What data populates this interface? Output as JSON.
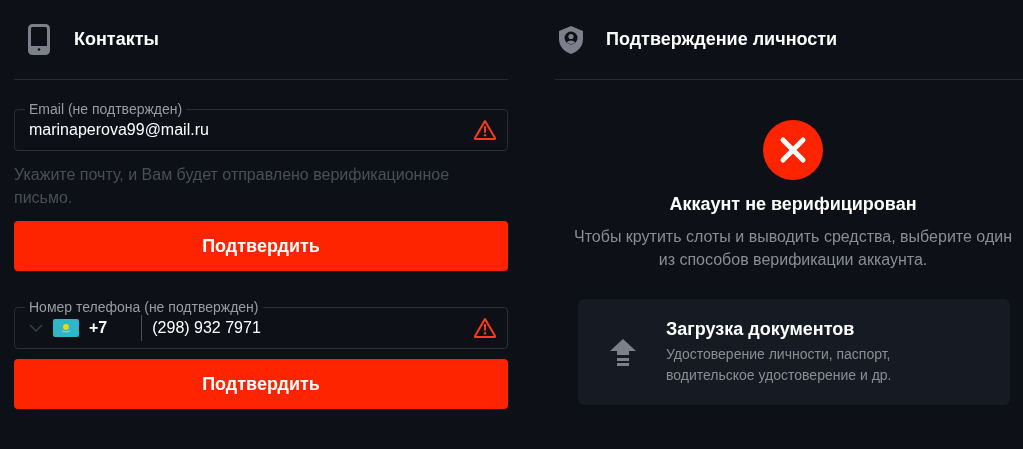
{
  "contacts": {
    "title": "Контакты",
    "fields": [
      {
        "kind": "email",
        "label": "Email (не подтвержден)",
        "value": "marinaperova99@mail.ru",
        "hint": "Укажите почту, и Вам будет отправлено верификационное письмо.",
        "button": "Подтвердить"
      },
      {
        "kind": "phone",
        "label": "Номер телефона (не подтвержден)",
        "country_code": "+7",
        "value": "(298) 932 7971",
        "button": "Подтвердить"
      }
    ]
  },
  "identity": {
    "title": "Подтверждение личности",
    "status_title": "Аккаунт не верифицирован",
    "status_text": "Чтобы крутить слоты и выводить средства, выберите один из способов верификации аккаунта.",
    "methods": [
      {
        "title": "Загрузка документов",
        "description": "Удостоверение личности, паспорт, водительское удостоверение и др."
      }
    ]
  }
}
